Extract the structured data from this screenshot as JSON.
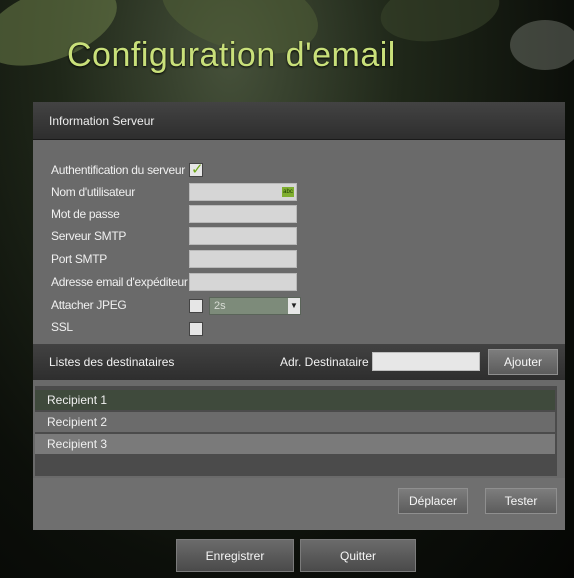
{
  "title": "Configuration d'email",
  "server": {
    "section_title": "Information Serveur",
    "auth_label": "Authentification du serveur",
    "auth_checked": true,
    "username_label": "Nom d'utilisateur",
    "username_value": "",
    "password_label": "Mot de passe",
    "smtp_server_label": "Serveur SMTP",
    "smtp_port_label": "Port SMTP",
    "sender_label": "Adresse email d'expéditeur",
    "attach_jpeg_label": "Attacher JPEG",
    "attach_jpeg_checked": false,
    "interval_value": "2s",
    "ssl_label": "SSL",
    "ssl_checked": false,
    "abc_badge": "abc"
  },
  "recipients": {
    "section_title": "Listes des destinataires",
    "address_label": "Adr. Destinataire",
    "add_button": "Ajouter",
    "items": [
      "Recipient 1",
      "Recipient 2",
      "Recipient 3"
    ],
    "move_button": "Déplacer",
    "test_button": "Tester"
  },
  "footer": {
    "save_button": "Enregistrer",
    "quit_button": "Quitter"
  },
  "colors": {
    "title": "#c9e07a",
    "panel": "#6a6a6a",
    "selected_row": "#3f4a3c",
    "accent_green": "#7fae2f"
  }
}
